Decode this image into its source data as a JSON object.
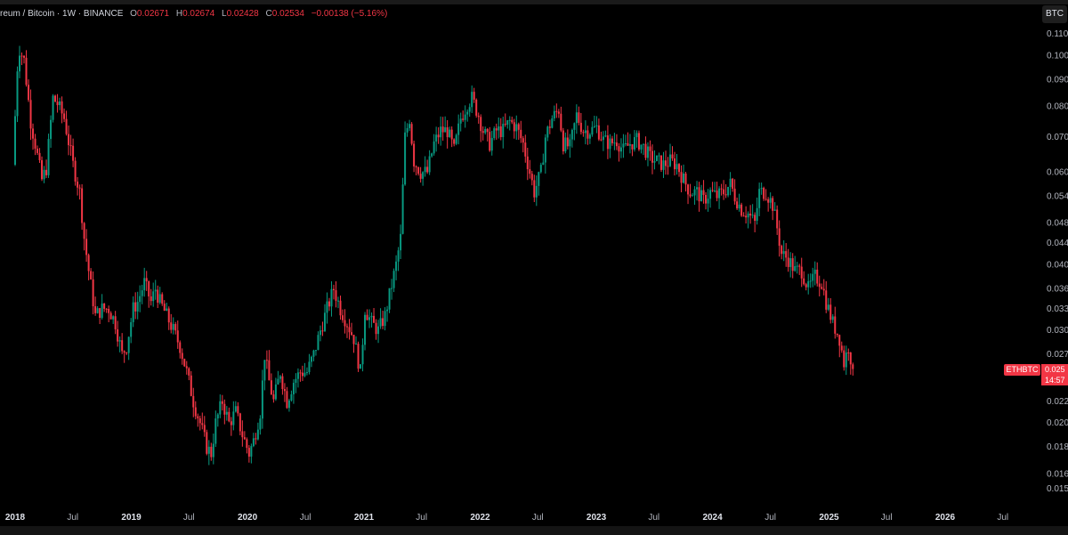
{
  "legend": {
    "title": "reum / Bitcoin · 1W · BINANCE",
    "o_label": "O",
    "o_value": "0.02671",
    "h_label": "H",
    "h_value": "0.02674",
    "l_label": "L",
    "l_value": "0.02428",
    "c_label": "C",
    "c_value": "0.02534",
    "change": "−0.00138 (−5.16%)"
  },
  "currency_button": "BTC",
  "last_price": {
    "symbol": "ETHBTC",
    "price": "0.025",
    "countdown": "14:57"
  },
  "colors": {
    "up": "#089981",
    "down": "#f23645",
    "background": "#000000",
    "text": "#d1d4dc"
  },
  "chart_data": {
    "type": "candlestick",
    "symbol": "ETHBTC",
    "interval": "1W",
    "exchange": "BINANCE",
    "y_scale": "log",
    "ylim": [
      0.0145,
      0.115
    ],
    "x_range": [
      "2017-12-25",
      "2026-12-31"
    ],
    "y_ticks": [
      "0.110",
      "0.100",
      "0.090",
      "0.080",
      "0.070",
      "0.060",
      "0.054",
      "0.048",
      "0.044",
      "0.040",
      "0.036",
      "0.033",
      "0.030",
      "0.027",
      "0.025",
      "0.022",
      "0.020",
      "0.018",
      "0.016",
      "0.015"
    ],
    "x_ticks": [
      "2018",
      "Jul",
      "2019",
      "Jul",
      "2020",
      "Jul",
      "2021",
      "Jul",
      "2022",
      "Jul",
      "2023",
      "Jul",
      "2024",
      "Jul",
      "2025",
      "Jul",
      "2026",
      "Jul"
    ],
    "grid": false,
    "price_path": [
      [
        "2017-12-25",
        0.062
      ],
      [
        "2018-01-08",
        0.095
      ],
      [
        "2018-01-15",
        0.103
      ],
      [
        "2018-01-29",
        0.098
      ],
      [
        "2018-02-19",
        0.075
      ],
      [
        "2018-03-05",
        0.068
      ],
      [
        "2018-03-26",
        0.058
      ],
      [
        "2018-04-09",
        0.061
      ],
      [
        "2018-04-30",
        0.083
      ],
      [
        "2018-05-14",
        0.081
      ],
      [
        "2018-06-04",
        0.076
      ],
      [
        "2018-07-02",
        0.062
      ],
      [
        "2018-07-23",
        0.055
      ],
      [
        "2018-08-06",
        0.045
      ],
      [
        "2018-08-20",
        0.039
      ],
      [
        "2018-09-10",
        0.032
      ],
      [
        "2018-10-01",
        0.033
      ],
      [
        "2018-10-22",
        0.033
      ],
      [
        "2018-11-12",
        0.031
      ],
      [
        "2018-12-03",
        0.027
      ],
      [
        "2018-12-17",
        0.028
      ],
      [
        "2019-01-07",
        0.033
      ],
      [
        "2019-01-21",
        0.034
      ],
      [
        "2019-02-11",
        0.037
      ],
      [
        "2019-03-04",
        0.034
      ],
      [
        "2019-03-18",
        0.036
      ],
      [
        "2019-04-01",
        0.034
      ],
      [
        "2019-04-22",
        0.032
      ],
      [
        "2019-05-13",
        0.03
      ],
      [
        "2019-06-03",
        0.028
      ],
      [
        "2019-06-24",
        0.025
      ],
      [
        "2019-07-15",
        0.022
      ],
      [
        "2019-08-05",
        0.02
      ],
      [
        "2019-08-26",
        0.018
      ],
      [
        "2019-09-09",
        0.0175
      ],
      [
        "2019-09-23",
        0.02
      ],
      [
        "2019-10-14",
        0.022
      ],
      [
        "2019-11-04",
        0.02
      ],
      [
        "2019-11-25",
        0.021
      ],
      [
        "2019-12-16",
        0.019
      ],
      [
        "2020-01-06",
        0.0175
      ],
      [
        "2020-01-20",
        0.0185
      ],
      [
        "2020-02-10",
        0.021
      ],
      [
        "2020-02-24",
        0.027
      ],
      [
        "2020-03-09",
        0.024
      ],
      [
        "2020-03-23",
        0.022
      ],
      [
        "2020-04-13",
        0.025
      ],
      [
        "2020-05-04",
        0.022
      ],
      [
        "2020-05-25",
        0.024
      ],
      [
        "2020-06-15",
        0.025
      ],
      [
        "2020-07-06",
        0.025
      ],
      [
        "2020-07-27",
        0.027
      ],
      [
        "2020-08-17",
        0.03
      ],
      [
        "2020-09-07",
        0.033
      ],
      [
        "2020-09-28",
        0.036
      ],
      [
        "2020-10-19",
        0.033
      ],
      [
        "2020-11-09",
        0.031
      ],
      [
        "2020-11-30",
        0.029
      ],
      [
        "2020-12-21",
        0.025
      ],
      [
        "2021-01-04",
        0.033
      ],
      [
        "2021-01-25",
        0.031
      ],
      [
        "2021-02-15",
        0.03
      ],
      [
        "2021-03-08",
        0.032
      ],
      [
        "2021-03-22",
        0.035
      ],
      [
        "2021-04-12",
        0.04
      ],
      [
        "2021-04-26",
        0.045
      ],
      [
        "2021-05-10",
        0.07
      ],
      [
        "2021-05-24",
        0.076
      ],
      [
        "2021-06-07",
        0.063
      ],
      [
        "2021-06-28",
        0.06
      ],
      [
        "2021-07-19",
        0.06
      ],
      [
        "2021-08-09",
        0.068
      ],
      [
        "2021-08-30",
        0.072
      ],
      [
        "2021-09-20",
        0.072
      ],
      [
        "2021-10-11",
        0.066
      ],
      [
        "2021-11-01",
        0.076
      ],
      [
        "2021-11-22",
        0.081
      ],
      [
        "2021-12-06",
        0.083
      ],
      [
        "2021-12-27",
        0.077
      ],
      [
        "2022-01-10",
        0.072
      ],
      [
        "2022-01-31",
        0.068
      ],
      [
        "2022-02-21",
        0.072
      ],
      [
        "2022-03-14",
        0.072
      ],
      [
        "2022-04-04",
        0.075
      ],
      [
        "2022-04-25",
        0.073
      ],
      [
        "2022-05-16",
        0.068
      ],
      [
        "2022-06-06",
        0.06
      ],
      [
        "2022-06-20",
        0.055
      ],
      [
        "2022-07-11",
        0.06
      ],
      [
        "2022-07-25",
        0.07
      ],
      [
        "2022-08-15",
        0.076
      ],
      [
        "2022-09-05",
        0.079
      ],
      [
        "2022-09-19",
        0.068
      ],
      [
        "2022-10-10",
        0.067
      ],
      [
        "2022-10-31",
        0.077
      ],
      [
        "2022-11-21",
        0.072
      ],
      [
        "2022-12-12",
        0.072
      ],
      [
        "2023-01-02",
        0.073
      ],
      [
        "2023-01-23",
        0.069
      ],
      [
        "2023-02-13",
        0.068
      ],
      [
        "2023-03-06",
        0.069
      ],
      [
        "2023-03-27",
        0.066
      ],
      [
        "2023-04-17",
        0.068
      ],
      [
        "2023-05-08",
        0.069
      ],
      [
        "2023-05-29",
        0.067
      ],
      [
        "2023-06-19",
        0.064
      ],
      [
        "2023-07-10",
        0.063
      ],
      [
        "2023-07-31",
        0.062
      ],
      [
        "2023-08-21",
        0.063
      ],
      [
        "2023-09-11",
        0.062
      ],
      [
        "2023-10-02",
        0.058
      ],
      [
        "2023-10-23",
        0.055
      ],
      [
        "2023-11-13",
        0.055
      ],
      [
        "2023-12-04",
        0.053
      ],
      [
        "2023-12-25",
        0.055
      ],
      [
        "2024-01-15",
        0.054
      ],
      [
        "2024-02-05",
        0.055
      ],
      [
        "2024-02-26",
        0.057
      ],
      [
        "2024-03-11",
        0.054
      ],
      [
        "2024-04-01",
        0.051
      ],
      [
        "2024-04-22",
        0.05
      ],
      [
        "2024-05-13",
        0.048
      ],
      [
        "2024-05-27",
        0.055
      ],
      [
        "2024-06-17",
        0.055
      ],
      [
        "2024-07-08",
        0.052
      ],
      [
        "2024-07-22",
        0.047
      ],
      [
        "2024-08-05",
        0.042
      ],
      [
        "2024-08-26",
        0.041
      ],
      [
        "2024-09-16",
        0.039
      ],
      [
        "2024-10-07",
        0.039
      ],
      [
        "2024-10-28",
        0.036
      ],
      [
        "2024-11-18",
        0.038
      ],
      [
        "2024-12-09",
        0.037
      ],
      [
        "2024-12-23",
        0.034
      ],
      [
        "2025-01-13",
        0.031
      ],
      [
        "2025-02-03",
        0.029
      ],
      [
        "2025-02-17",
        0.026
      ],
      [
        "2025-03-03",
        0.028
      ],
      [
        "2025-03-17",
        0.02534
      ]
    ]
  }
}
